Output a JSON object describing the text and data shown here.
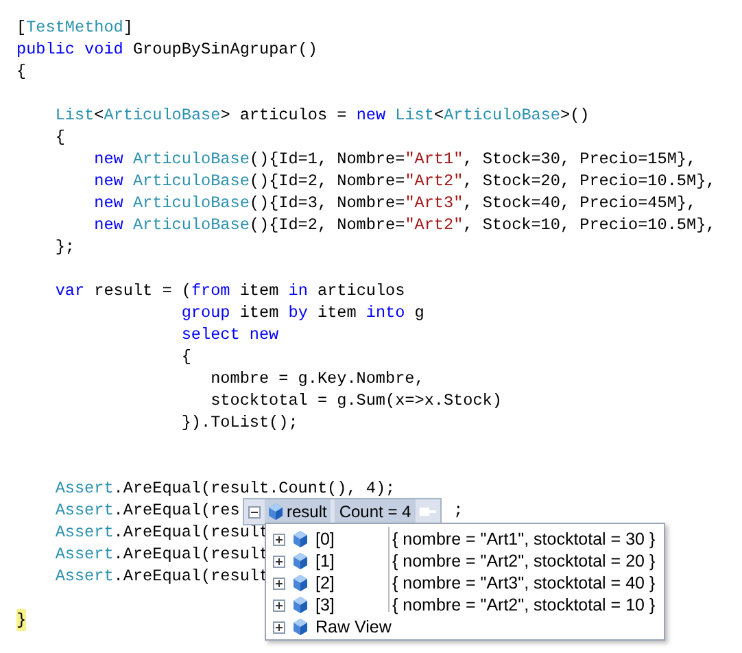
{
  "code_lines": [
    {
      "kind": "top",
      "tokens": [
        {
          "kind": "plain",
          "text": "["
        },
        {
          "kind": "type",
          "text": "TestMethod"
        },
        {
          "kind": "plain",
          "text": "]"
        }
      ]
    },
    {
      "kind": "top",
      "tokens": [
        {
          "kind": "keyword",
          "text": "public void"
        },
        {
          "kind": "plain",
          "text": " GroupBySinAgrupar()"
        }
      ]
    },
    {
      "kind": "top",
      "tokens": [
        {
          "kind": "plain",
          "text": "{"
        }
      ]
    },
    {
      "kind": "blank"
    },
    {
      "kind": "block",
      "tokens": [
        {
          "kind": "type",
          "text": "List"
        },
        {
          "kind": "plain",
          "text": "<"
        },
        {
          "kind": "type",
          "text": "ArticuloBase"
        },
        {
          "kind": "plain",
          "text": "> articulos = "
        },
        {
          "kind": "keyword",
          "text": "new"
        },
        {
          "kind": "type",
          "text": " List"
        },
        {
          "kind": "plain",
          "text": "<"
        },
        {
          "kind": "type",
          "text": "ArticuloBase"
        },
        {
          "kind": "plain",
          "text": ">()"
        }
      ]
    },
    {
      "kind": "block",
      "tokens": [
        {
          "kind": "plain",
          "text": "{"
        }
      ]
    },
    {
      "kind": "item",
      "tokens": [
        {
          "kind": "keyword",
          "text": "new"
        },
        {
          "kind": "type",
          "text": " ArticuloBase"
        },
        {
          "kind": "plain",
          "text": "(){Id=1, Nombre="
        },
        {
          "kind": "string",
          "text": "\"Art1\""
        },
        {
          "kind": "plain",
          "text": ", Stock=30, Precio=15M},"
        }
      ]
    },
    {
      "kind": "item",
      "tokens": [
        {
          "kind": "keyword",
          "text": "new"
        },
        {
          "kind": "type",
          "text": " ArticuloBase"
        },
        {
          "kind": "plain",
          "text": "(){Id=2, Nombre="
        },
        {
          "kind": "string",
          "text": "\"Art2\""
        },
        {
          "kind": "plain",
          "text": ", Stock=20, Precio=10.5M},"
        }
      ]
    },
    {
      "kind": "item",
      "tokens": [
        {
          "kind": "keyword",
          "text": "new"
        },
        {
          "kind": "type",
          "text": " ArticuloBase"
        },
        {
          "kind": "plain",
          "text": "(){Id=3, Nombre="
        },
        {
          "kind": "string",
          "text": "\"Art3\""
        },
        {
          "kind": "plain",
          "text": ", Stock=40, Precio=45M},"
        }
      ]
    },
    {
      "kind": "item",
      "tokens": [
        {
          "kind": "keyword",
          "text": "new"
        },
        {
          "kind": "type",
          "text": " ArticuloBase"
        },
        {
          "kind": "plain",
          "text": "(){Id=2, Nombre="
        },
        {
          "kind": "string",
          "text": "\"Art2\""
        },
        {
          "kind": "plain",
          "text": ", Stock=10, Precio=10.5M},"
        }
      ]
    },
    {
      "kind": "block",
      "tokens": [
        {
          "kind": "plain",
          "text": "};"
        }
      ]
    },
    {
      "kind": "blank"
    },
    {
      "kind": "block",
      "tokens": [
        {
          "kind": "keyword",
          "text": "var"
        },
        {
          "kind": "plain",
          "text": " result = ("
        },
        {
          "kind": "keyword",
          "text": "from"
        },
        {
          "kind": "plain",
          "text": " item "
        },
        {
          "kind": "keyword",
          "text": "in"
        },
        {
          "kind": "plain",
          "text": " articulos"
        }
      ]
    },
    {
      "kind": "query",
      "tokens": [
        {
          "kind": "keyword",
          "text": "group"
        },
        {
          "kind": "plain",
          "text": " item "
        },
        {
          "kind": "keyword",
          "text": "by"
        },
        {
          "kind": "plain",
          "text": " item "
        },
        {
          "kind": "keyword",
          "text": "into"
        },
        {
          "kind": "plain",
          "text": " g"
        }
      ]
    },
    {
      "kind": "query",
      "tokens": [
        {
          "kind": "keyword",
          "text": "select new"
        }
      ]
    },
    {
      "kind": "query",
      "tokens": [
        {
          "kind": "plain",
          "text": "{"
        }
      ]
    },
    {
      "kind": "member",
      "tokens": [
        {
          "kind": "plain",
          "text": "nombre = g.Key.Nombre,"
        }
      ]
    },
    {
      "kind": "member",
      "tokens": [
        {
          "kind": "plain",
          "text": "stocktotal = g.Sum(x=>x.Stock)"
        }
      ]
    },
    {
      "kind": "query",
      "tokens": [
        {
          "kind": "plain",
          "text": "}).ToList();"
        }
      ]
    },
    {
      "kind": "blank"
    },
    {
      "kind": "blank"
    },
    {
      "kind": "block",
      "tokens": [
        {
          "kind": "type",
          "text": "Assert"
        },
        {
          "kind": "plain",
          "text": ".AreEqual(result.Count(), 4);"
        }
      ]
    },
    {
      "kind": "block",
      "tokens": [
        {
          "kind": "type",
          "text": "Assert"
        },
        {
          "kind": "plain",
          "text": ".AreEqual(res"
        },
        {
          "kind": "gap"
        },
        {
          "kind": "plain",
          "text": ";"
        }
      ]
    },
    {
      "kind": "block",
      "tokens": [
        {
          "kind": "type",
          "text": "Assert"
        },
        {
          "kind": "plain",
          "text": ".AreEqual(result"
        }
      ]
    },
    {
      "kind": "block",
      "tokens": [
        {
          "kind": "type",
          "text": "Assert"
        },
        {
          "kind": "plain",
          "text": ".AreEqual(result"
        }
      ]
    },
    {
      "kind": "block",
      "tokens": [
        {
          "kind": "type",
          "text": "Assert"
        },
        {
          "kind": "plain",
          "text": ".AreEqual(result"
        }
      ]
    },
    {
      "kind": "blank"
    },
    {
      "kind": "current",
      "tokens": [
        {
          "kind": "plain",
          "text": "}"
        }
      ]
    }
  ],
  "datatip": {
    "name": "result",
    "value": "Count = 4",
    "expanded": true,
    "rows": [
      {
        "name": "[0]",
        "value": "{ nombre = \"Art1\", stocktotal = 30 }",
        "expanded": false
      },
      {
        "name": "[1]",
        "value": "{ nombre = \"Art2\", stocktotal = 20 }",
        "expanded": false
      },
      {
        "name": "[2]",
        "value": "{ nombre = \"Art3\", stocktotal = 40 }",
        "expanded": false
      },
      {
        "name": "[3]",
        "value": "{ nombre = \"Art2\", stocktotal = 10 }",
        "expanded": false
      },
      {
        "name": "Raw View",
        "expanded": false
      }
    ]
  }
}
